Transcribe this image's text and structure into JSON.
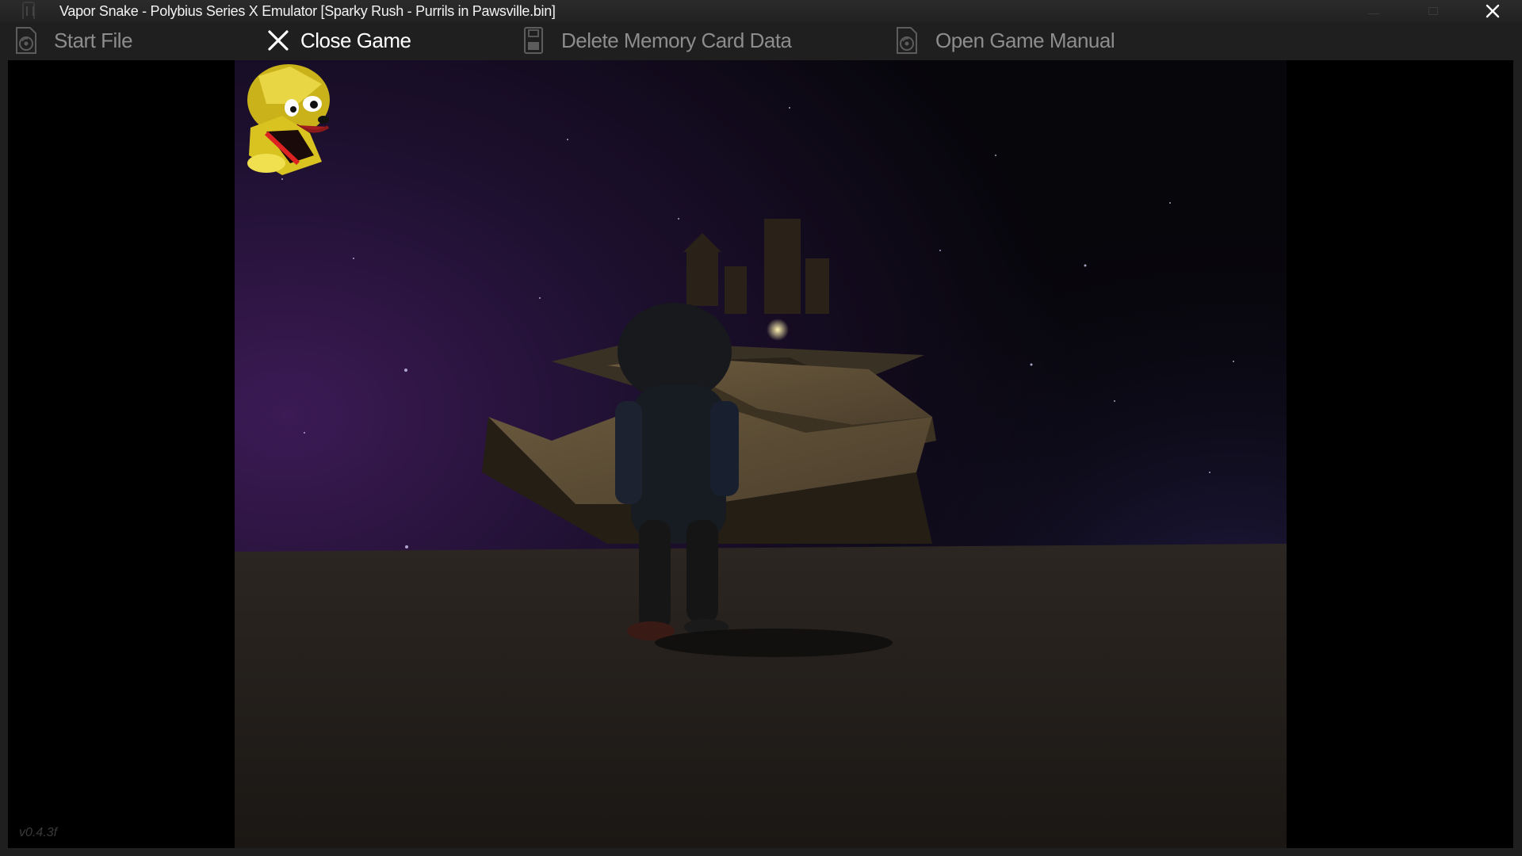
{
  "window": {
    "title": "Vapor Snake - Polybius Series X Emulator [Sparky Rush - Purrils in Pawsville.bin]",
    "controls": {
      "minimize_icon": "minimize-icon",
      "maximize_icon": "maximize-icon",
      "close_icon": "close-icon"
    }
  },
  "toolbar": {
    "items": [
      {
        "label": "Start File",
        "icon": "disc-file-icon",
        "active": false
      },
      {
        "label": "Close Game",
        "icon": "close-icon",
        "active": true
      },
      {
        "label": "Delete Memory Card Data",
        "icon": "memory-card-icon",
        "active": false
      },
      {
        "label": "Open Game Manual",
        "icon": "manual-file-icon",
        "active": false
      }
    ]
  },
  "game": {
    "hud_icon": "dog-character-portrait",
    "scene": "night-sky-zigzag-path-with-character"
  },
  "status": {
    "version": "v0.4.3f"
  },
  "colors": {
    "titlebar_bg": "#222222",
    "toolbar_bg": "#1f1f1f",
    "active_text": "#ffffff",
    "inactive_text": "#8d8d8d",
    "display_bg": "#000000"
  }
}
